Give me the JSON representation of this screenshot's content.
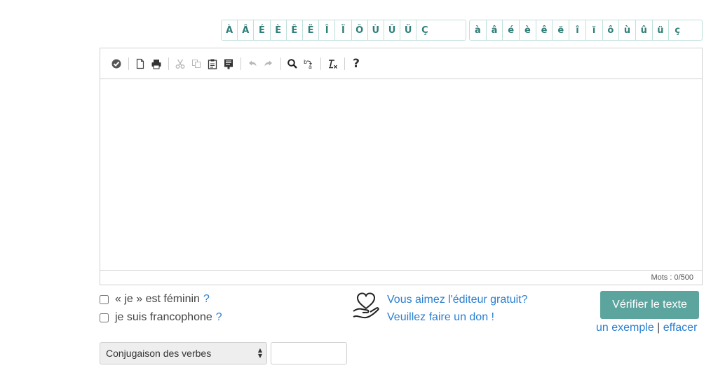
{
  "accents": {
    "upper": [
      "À",
      "Â",
      "É",
      "È",
      "Ê",
      "Ë",
      "Î",
      "Ï",
      "Ô",
      "Ù",
      "Û",
      "Ü",
      "Ç"
    ],
    "lower": [
      "à",
      "â",
      "é",
      "è",
      "ê",
      "ë",
      "î",
      "ï",
      "ô",
      "ù",
      "û",
      "ü",
      "ç"
    ]
  },
  "toolbar": {
    "icons": [
      "spellcheck-icon",
      "new-document-icon",
      "print-icon",
      "cut-icon",
      "copy-icon",
      "paste-icon",
      "paste-text-icon",
      "undo-icon",
      "redo-icon",
      "find-icon",
      "replace-icon",
      "remove-format-icon",
      "help-icon"
    ],
    "help_label": "?"
  },
  "editor": {
    "word_count": "Mots : 0/500"
  },
  "options": {
    "feminin_label": "« je » est féminin",
    "feminin_help": "?",
    "francophone_label": "je suis francophone",
    "francophone_help": "?"
  },
  "donation": {
    "line1": "Vous aimez l'éditeur gratuit?",
    "line2": "Veuillez faire un don !"
  },
  "actions": {
    "check_label": "Vérifier le texte",
    "example_link": "un exemple",
    "separator": "|",
    "clear_link": "effacer"
  },
  "conjugation": {
    "selected": "Conjugaison des verbes",
    "input_value": ""
  },
  "colors": {
    "accent_teal": "#5ba59e",
    "link_blue": "#2a7fd0"
  }
}
